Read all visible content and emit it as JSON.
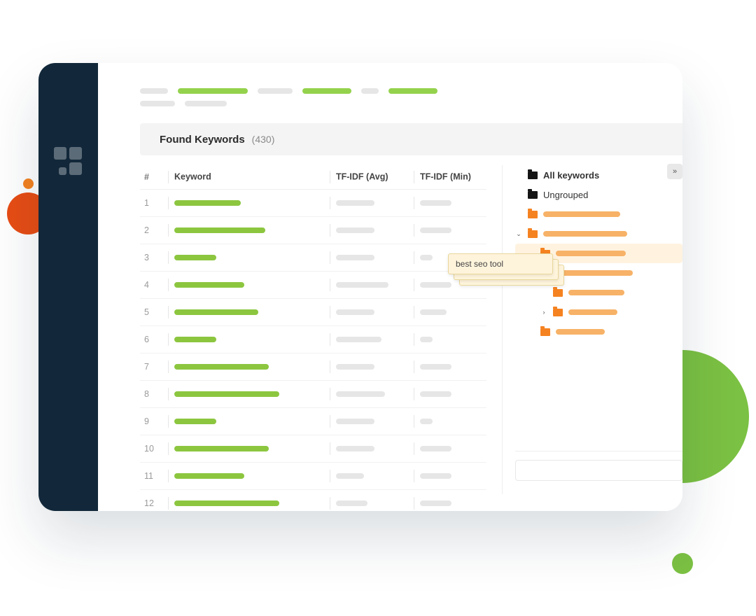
{
  "section": {
    "title": "Found Keywords",
    "count_label": "(430)"
  },
  "columns": {
    "num": "#",
    "keyword": "Keyword",
    "avg": "TF-IDF (Avg)",
    "min": "TF-IDF (Min)"
  },
  "rows": [
    {
      "n": "1",
      "kw": 95,
      "avg": 55,
      "min": 45
    },
    {
      "n": "2",
      "kw": 130,
      "avg": 55,
      "min": 45
    },
    {
      "n": "3",
      "kw": 60,
      "avg": 55,
      "min": 18
    },
    {
      "n": "4",
      "kw": 100,
      "avg": 75,
      "min": 45
    },
    {
      "n": "5",
      "kw": 120,
      "avg": 55,
      "min": 38
    },
    {
      "n": "6",
      "kw": 60,
      "avg": 65,
      "min": 18
    },
    {
      "n": "7",
      "kw": 135,
      "avg": 55,
      "min": 45
    },
    {
      "n": "8",
      "kw": 150,
      "avg": 70,
      "min": 45
    },
    {
      "n": "9",
      "kw": 60,
      "avg": 55,
      "min": 18
    },
    {
      "n": "10",
      "kw": 135,
      "avg": 55,
      "min": 45
    },
    {
      "n": "11",
      "kw": 100,
      "avg": 40,
      "min": 45
    },
    {
      "n": "12",
      "kw": 150,
      "avg": 45,
      "min": 45
    }
  ],
  "groups": {
    "all": "All keywords",
    "ungrouped": "Ungrouped"
  },
  "tooltip": "best seo tool"
}
